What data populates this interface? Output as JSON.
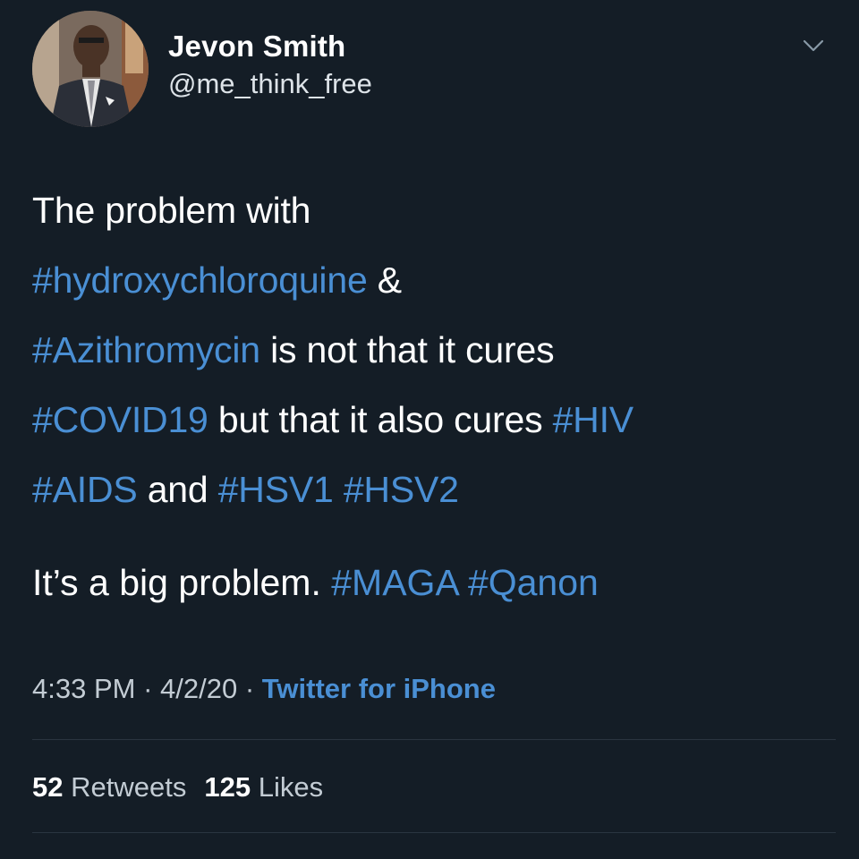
{
  "tweet": {
    "author": {
      "display_name": "Jevon Smith",
      "handle": "@me_think_free",
      "avatar": "profile-photo"
    },
    "menu_icon": "chevron-down-icon",
    "body_lines": [
      [
        {
          "text": "The problem with",
          "hashtag": false
        }
      ],
      [
        {
          "text": "#hydroxychloroquine",
          "hashtag": true
        },
        {
          "text": " &",
          "hashtag": false
        }
      ],
      [
        {
          "text": "#Azithromycin",
          "hashtag": true
        },
        {
          "text": " is not that it cures",
          "hashtag": false
        }
      ],
      [
        {
          "text": "#COVID19",
          "hashtag": true
        },
        {
          "text": " but that it also cures ",
          "hashtag": false
        },
        {
          "text": "#HIV",
          "hashtag": true
        }
      ],
      [
        {
          "text": "#AIDS",
          "hashtag": true
        },
        {
          "text": " and ",
          "hashtag": false
        },
        {
          "text": "#HSV1",
          "hashtag": true
        },
        {
          "text": " ",
          "hashtag": false
        },
        {
          "text": "#HSV2",
          "hashtag": true
        }
      ]
    ],
    "second_paragraph": [
      {
        "text": "It’s a big problem. ",
        "hashtag": false
      },
      {
        "text": "#MAGA",
        "hashtag": true
      },
      {
        "text": " ",
        "hashtag": false
      },
      {
        "text": "#Qanon",
        "hashtag": true
      }
    ],
    "meta": {
      "time": "4:33 PM",
      "separator": " · ",
      "date": "4/2/20",
      "source": "Twitter for iPhone"
    },
    "stats": {
      "retweets_count": "52",
      "retweets_label": "Retweets",
      "likes_count": "125",
      "likes_label": "Likes"
    }
  },
  "colors": {
    "background": "#141d26",
    "hashtag": "#4a8fd4",
    "text": "#ffffff",
    "secondary_text": "#c3ccd4",
    "divider": "#2a3540"
  }
}
